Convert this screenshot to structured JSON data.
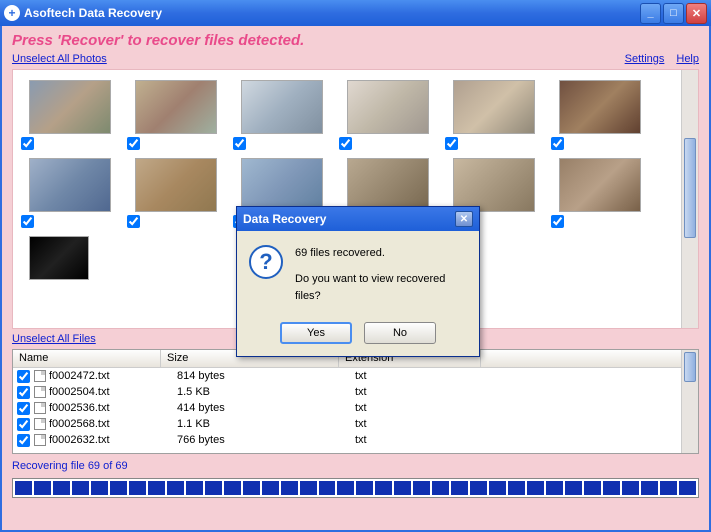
{
  "window": {
    "title": "Asoftech Data Recovery"
  },
  "instruction": "Press 'Recover' to recover files detected.",
  "links": {
    "unselect_photos": "Unselect All Photos",
    "unselect_files": "Unselect All Files",
    "settings": "Settings",
    "help": "Help"
  },
  "file_table": {
    "headers": {
      "name": "Name",
      "size": "Size",
      "ext": "Extension"
    },
    "rows": [
      {
        "name": "f0002472.txt",
        "size": "814 bytes",
        "ext": "txt"
      },
      {
        "name": "f0002504.txt",
        "size": "1.5 KB",
        "ext": "txt"
      },
      {
        "name": "f0002536.txt",
        "size": "414 bytes",
        "ext": "txt"
      },
      {
        "name": "f0002568.txt",
        "size": "1.1 KB",
        "ext": "txt"
      },
      {
        "name": "f0002632.txt",
        "size": "766 bytes",
        "ext": "txt"
      }
    ]
  },
  "status": "Recovering file 69 of 69",
  "dialog": {
    "title": "Data Recovery",
    "line1": "69 files recovered.",
    "line2": "Do you want to view recovered files?",
    "yes": "Yes",
    "no": "No"
  }
}
